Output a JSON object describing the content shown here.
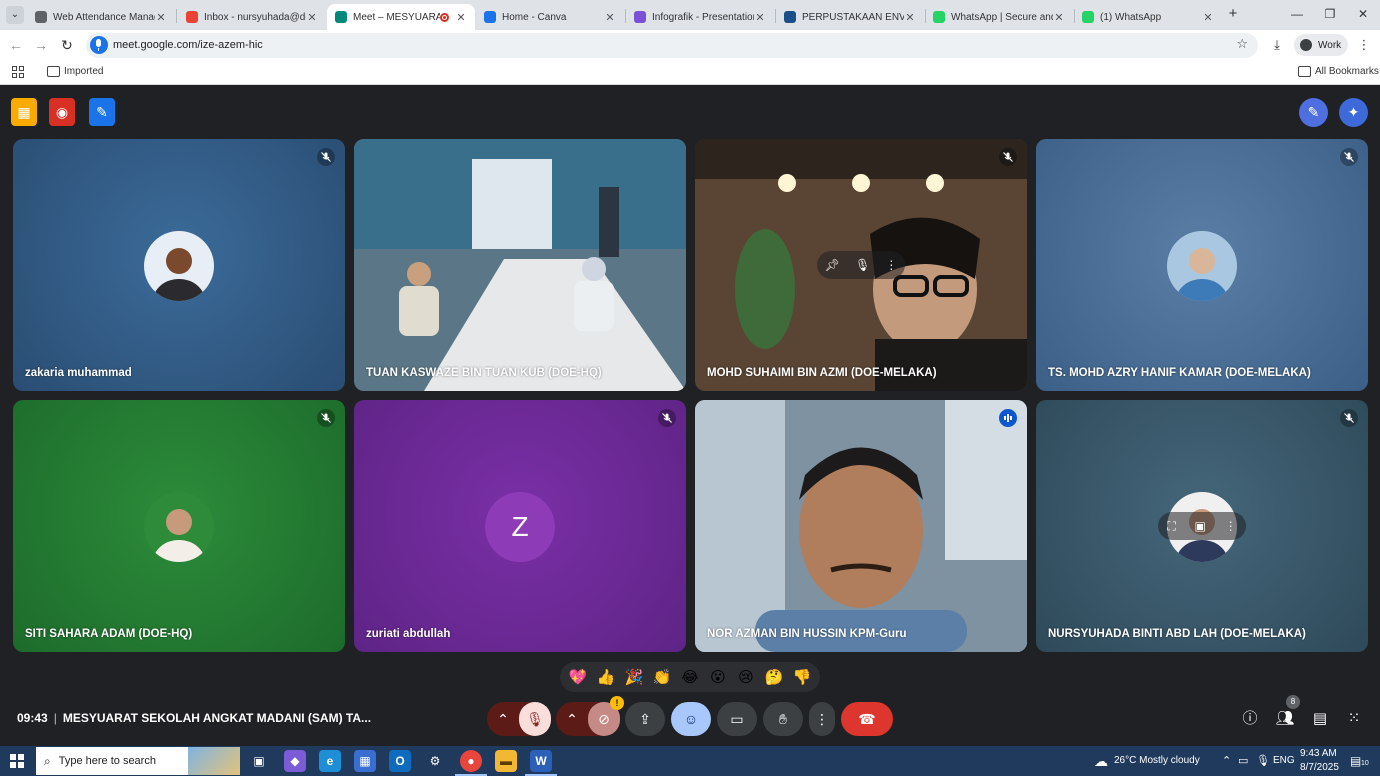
{
  "browser": {
    "tabs": [
      {
        "title": "Web Attendance Manage",
        "active": false,
        "favicon_color": "#5f6368"
      },
      {
        "title": "Inbox - nursyuhada@doe",
        "active": false,
        "favicon_color": "#ea4335"
      },
      {
        "title": "Meet – MESYUARAT S",
        "active": true,
        "favicon_color": "#00897b"
      },
      {
        "title": "Home - Canva",
        "active": false,
        "favicon_color": "#1a73e8"
      },
      {
        "title": "Infografik - Presentation (",
        "active": false,
        "favicon_color": "#7b4fd6"
      },
      {
        "title": "PERPUSTAKAAN ENVIRO",
        "active": false,
        "favicon_color": "#1b4f8a"
      },
      {
        "title": "WhatsApp | Secure and R",
        "active": false,
        "favicon_color": "#25d366"
      },
      {
        "title": "(1) WhatsApp",
        "active": false,
        "favicon_color": "#25d366"
      }
    ],
    "url": "meet.google.com/ize-azem-hic",
    "profile_label": "Work",
    "bookmarks": {
      "imported": "Imported",
      "all": "All Bookmarks"
    }
  },
  "meet": {
    "participants": [
      {
        "name": "zakaria muhammad",
        "kind": "avatar",
        "muted": true,
        "speaking": false,
        "bg": [
          "#3b6b99",
          "#2a4d73"
        ],
        "avatar_icon": "man-portrait"
      },
      {
        "name": "TUAN KASWAZE BIN TUAN KUB (DOE-HQ)",
        "kind": "video",
        "muted": false,
        "speaking": false,
        "bg": [
          "#6d8fa3",
          "#3e4d57"
        ],
        "avatar_icon": "meeting-room-video"
      },
      {
        "name": "MOHD SUHAIMI BIN AZMI (DOE-MELAKA)",
        "kind": "video",
        "muted": true,
        "speaking": false,
        "bg": [
          "#4a3a2d",
          "#1f1a16"
        ],
        "avatar_icon": "man-glasses-video"
      },
      {
        "name": "TS. MOHD AZRY HANIF KAMAR (DOE-MELAKA)",
        "kind": "avatar",
        "muted": true,
        "speaking": false,
        "bg": [
          "#5a7ea5",
          "#3b5f86"
        ],
        "avatar_icon": "globe-hands"
      },
      {
        "name": "SITI SAHARA ADAM (DOE-HQ)",
        "kind": "avatar",
        "muted": true,
        "speaking": false,
        "bg": [
          "#2c8c3a",
          "#1d6b2b"
        ],
        "avatar_icon": "woman-hijab"
      },
      {
        "name": "zuriati abdullah",
        "kind": "letter",
        "letter": "Z",
        "muted": true,
        "speaking": false,
        "bg": [
          "#7a2fa6",
          "#5e2486"
        ],
        "avatar_icon": "letter-avatar"
      },
      {
        "name": "NOR AZMAN BIN HUSSIN KPM-Guru",
        "kind": "video",
        "muted": false,
        "speaking": true,
        "bg": [
          "#8aa0b2",
          "#40515e"
        ],
        "avatar_icon": "man-speaking-video"
      },
      {
        "name": "NURSYUHADA BINTI ABD LAH (DOE-MELAKA)",
        "kind": "avatar",
        "muted": true,
        "speaking": false,
        "bg": [
          "#45667a",
          "#2e4a5a"
        ],
        "avatar_icon": "woman-hijab-dark"
      }
    ],
    "reactions": [
      "💖",
      "👍",
      "🎉",
      "👏",
      "😂",
      "😮",
      "😢",
      "🤔",
      "👎"
    ],
    "time": "09:43",
    "meeting_title": "MESYUARAT SEKOLAH ANGKAT MADANI (SAM) TA...",
    "people_count": "8",
    "accent": "#a8c7fa",
    "end_call_color": "#dc362e"
  },
  "taskbar": {
    "search_placeholder": "Type here to search",
    "weather": "26°C  Mostly cloudy",
    "language": "ENG",
    "clock_time": "9:43 AM",
    "clock_date": "8/7/2025",
    "notification_count": "10"
  }
}
